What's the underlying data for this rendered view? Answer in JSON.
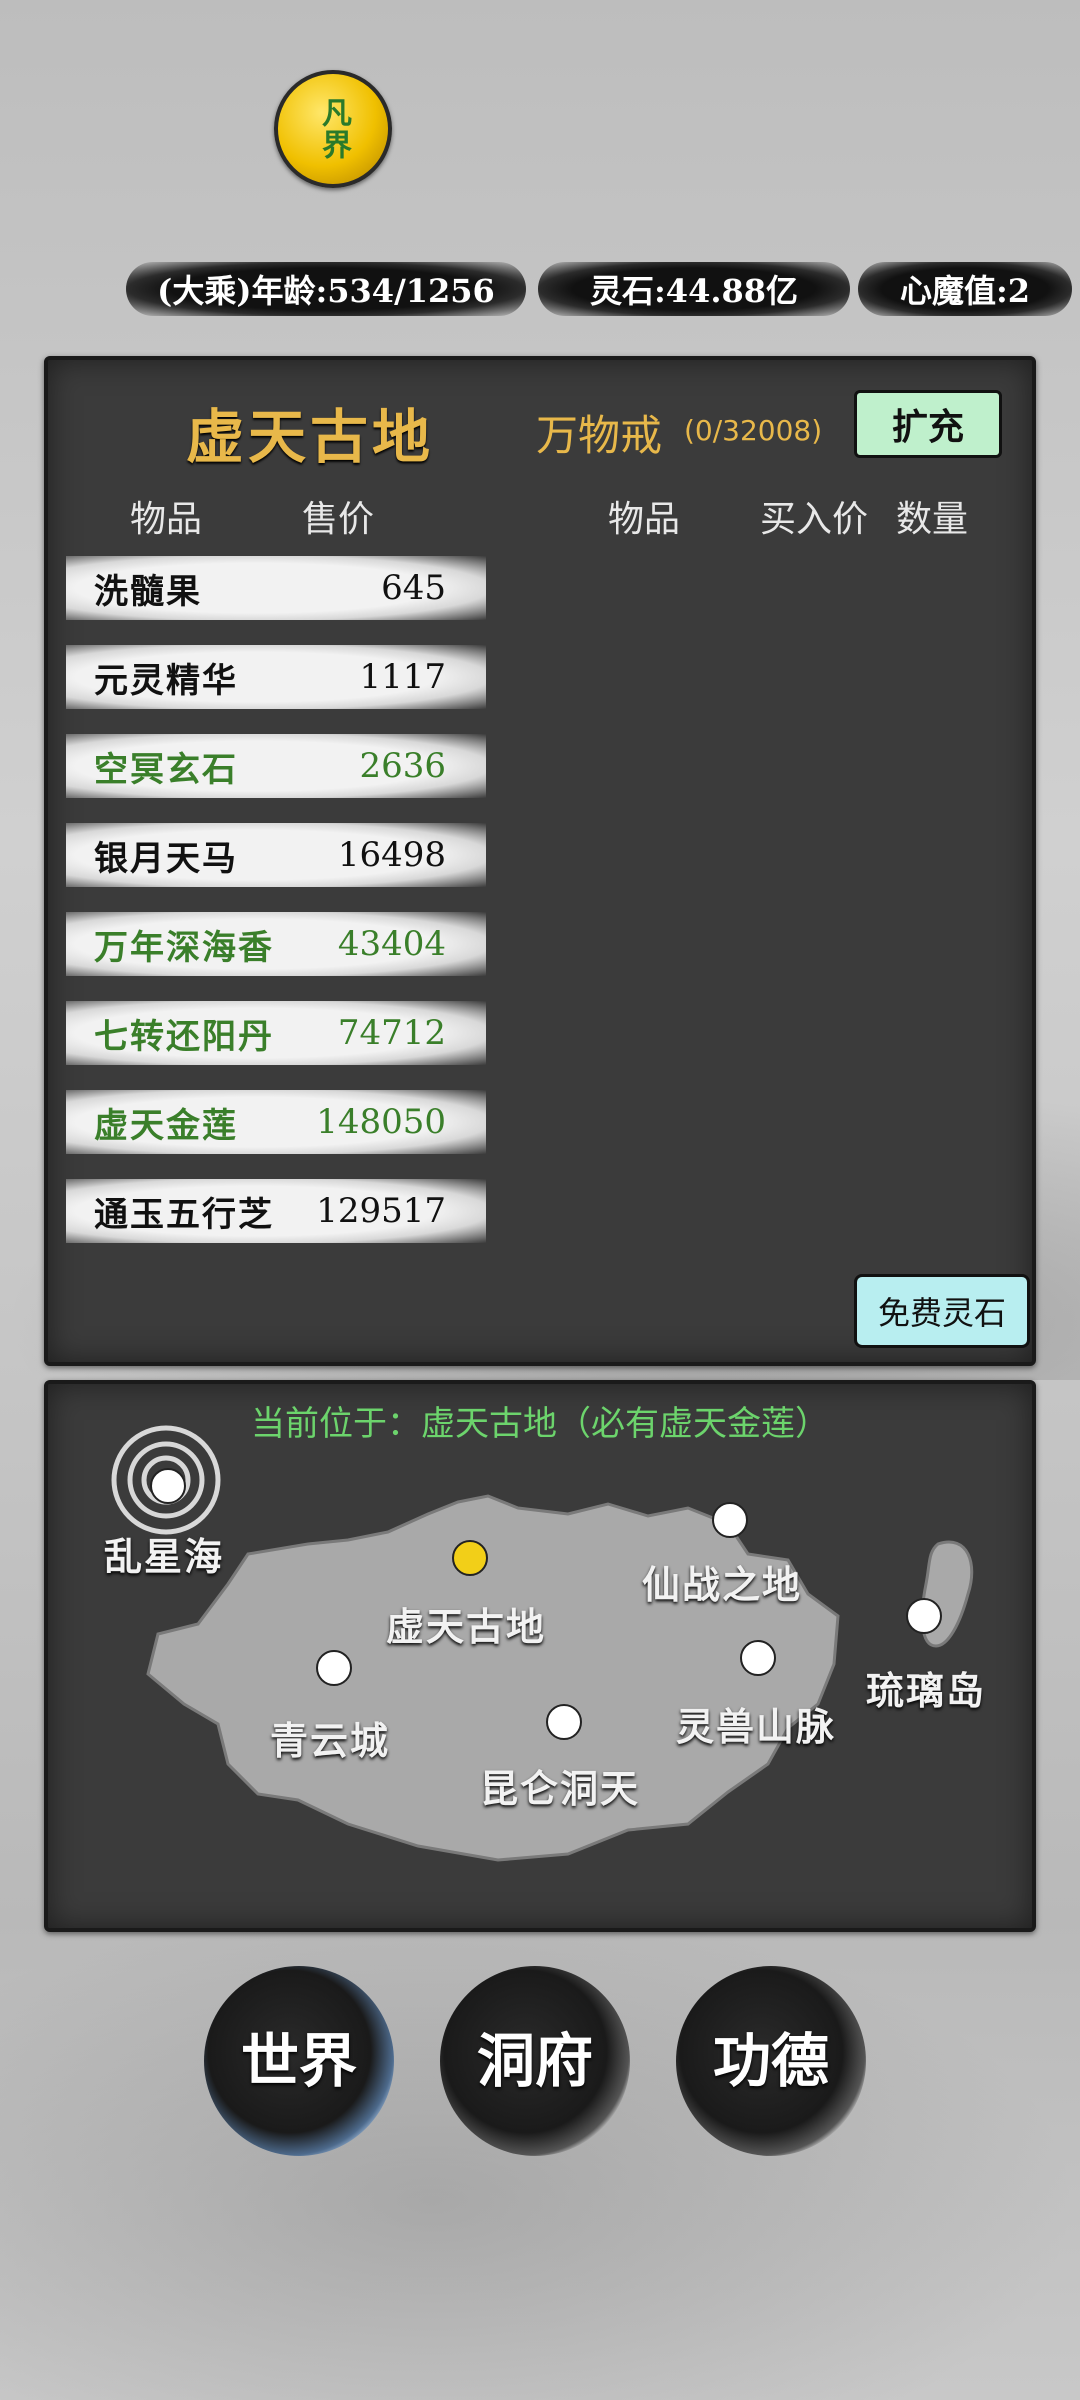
{
  "badge": {
    "label": "凡界"
  },
  "status": {
    "age": "(大乘)年龄:534/1256",
    "spirit_stones": "灵石:44.88亿",
    "demon_value": "心魔值:2"
  },
  "market": {
    "location_title": "虚天古地",
    "ring_title": "万物戒",
    "ring_capacity": "(0/32008)",
    "expand_button": "扩充",
    "columns": {
      "item": "物品",
      "sell_price": "售价",
      "item2": "物品",
      "buy_price": "买入价",
      "quantity": "数量"
    },
    "goods": [
      {
        "name": "洗髓果",
        "price": "645",
        "rare": false
      },
      {
        "name": "元灵精华",
        "price": "1117",
        "rare": false
      },
      {
        "name": "空冥玄石",
        "price": "2636",
        "rare": true
      },
      {
        "name": "银月天马",
        "price": "16498",
        "rare": false
      },
      {
        "name": "万年深海香",
        "price": "43404",
        "rare": true
      },
      {
        "name": "七转还阳丹",
        "price": "74712",
        "rare": true
      },
      {
        "name": "虚天金莲",
        "price": "148050",
        "rare": true
      },
      {
        "name": "通玉五行芝",
        "price": "129517",
        "rare": false
      }
    ],
    "free_button": "免费灵石"
  },
  "map": {
    "current_location": "当前位于：虚天古地（必有虚天金莲）",
    "places": {
      "luanxinghai": "乱星海",
      "xutiangudi": "虚天古地",
      "xianzhanzhidi": "仙战之地",
      "liulidao": "琉璃岛",
      "qingyuncheng": "青云城",
      "lingshoushanmai": "灵兽山脉",
      "kunlundongtian": "昆仑洞天"
    }
  },
  "nav": {
    "world": "世界",
    "cave": "洞府",
    "merit": "功德"
  },
  "colors": {
    "gold_text": "#e8b84a",
    "rare_green": "#3a7f2a",
    "current_node": "#f2cf18",
    "location_green": "#6cd46c"
  }
}
